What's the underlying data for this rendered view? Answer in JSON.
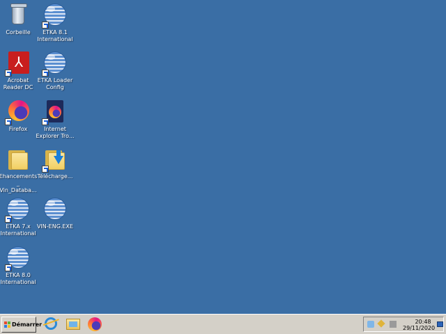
{
  "desktop": {
    "background_color": "#3a6ea5",
    "icons": [
      {
        "label_line1": "Corbeille",
        "label_line2": "",
        "icon": "recycle-bin-icon"
      },
      {
        "label_line1": "ETKA 8.1",
        "label_line2": "International",
        "icon": "etka-globe-icon"
      },
      {
        "label_line1": "Acrobat",
        "label_line2": "Reader DC",
        "icon": "acrobat-reader-icon"
      },
      {
        "label_line1": "ETKA Loader",
        "label_line2": "Config",
        "icon": "etka-globe-icon"
      },
      {
        "label_line1": "Firefox",
        "label_line2": "",
        "icon": "firefox-icon"
      },
      {
        "label_line1": "Internet",
        "label_line2": "Explorer Tro...",
        "icon": "firefox-app-icon"
      },
      {
        "label_line1": "Ehancements_",
        "label_line2": "Vin_Databa...",
        "icon": "folder-icon"
      },
      {
        "label_line1": "Télécharge...",
        "label_line2": "",
        "icon": "downloads-folder-icon"
      },
      {
        "label_line1": "ETKA 7.x",
        "label_line2": "International",
        "icon": "etka-globe-icon"
      },
      {
        "label_line1": "VIN-ENG.EXE",
        "label_line2": "",
        "icon": "etka-globe-icon"
      },
      {
        "label_line1": "ETKA 8.0",
        "label_line2": "International",
        "icon": "etka-globe-icon"
      }
    ]
  },
  "taskbar": {
    "start_label": "Démarrer",
    "quick_launch": [
      "internet-explorer-icon",
      "explorer-folder-icon",
      "firefox-icon"
    ],
    "tray": {
      "icons": [
        "info-tray-icon",
        "network-tray-icon",
        "volume-tray-icon"
      ],
      "time": "20:48",
      "date": "29/11/2020"
    }
  }
}
